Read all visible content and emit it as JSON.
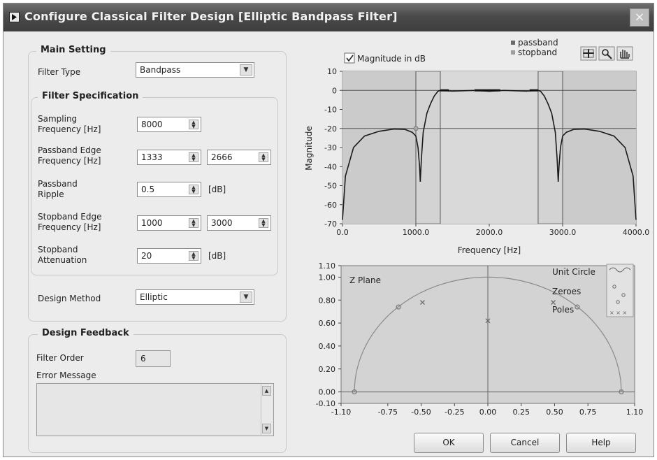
{
  "window": {
    "title": "Configure Classical Filter Design [Elliptic Bandpass Filter]",
    "close_glyph": "×"
  },
  "main_setting": {
    "group_label": "Main Setting",
    "filter_type_label": "Filter Type",
    "filter_type_value": "Bandpass",
    "design_method_label": "Design Method",
    "design_method_value": "Elliptic"
  },
  "filter_spec": {
    "group_label": "Filter Specification",
    "sampling_freq_label": [
      "Sampling",
      "Frequency [Hz]"
    ],
    "sampling_freq_value": "8000",
    "passband_edge_label": [
      "Passband Edge",
      "Frequency [Hz]"
    ],
    "passband_edge_low": "1333",
    "passband_edge_high": "2666",
    "passband_ripple_label": [
      "Passband",
      "Ripple"
    ],
    "passband_ripple_value": "0.5",
    "passband_ripple_unit": "[dB]",
    "stopband_edge_label": [
      "Stopband Edge",
      "Frequency [Hz]"
    ],
    "stopband_edge_low": "1000",
    "stopband_edge_high": "3000",
    "stopband_atten_label": [
      "Stopband",
      "Attenuation"
    ],
    "stopband_atten_value": "20",
    "stopband_atten_unit": "[dB]"
  },
  "feedback": {
    "group_label": "Design Feedback",
    "filter_order_label": "Filter Order",
    "filter_order_value": "6",
    "error_message_label": "Error Message",
    "error_message_value": ""
  },
  "magnitude_plot": {
    "checkbox_label": "Magnitude in dB",
    "checkbox_checked": true,
    "legend": [
      "passband",
      "stopband"
    ],
    "tool_icons": [
      "cursor-grid-icon",
      "zoom-icon",
      "pan-hand-icon"
    ],
    "xlabel": "Frequency [Hz]",
    "ylabel": "Magnitude"
  },
  "zplane_plot": {
    "label": "Z Plane",
    "legend": [
      "Unit Circle",
      "Zeroes",
      "Poles"
    ]
  },
  "buttons": {
    "ok": "OK",
    "cancel": "Cancel",
    "help": "Help"
  },
  "chart_data": [
    {
      "type": "line",
      "title": "",
      "xlabel": "Frequency [Hz]",
      "ylabel": "Magnitude",
      "xlim": [
        0,
        4000
      ],
      "ylim": [
        -70,
        10
      ],
      "x_ticks": [
        "0.0",
        "1000.0",
        "2000.0",
        "3000.0",
        "4000.0"
      ],
      "y_ticks": [
        "10",
        "0",
        "-10",
        "-20",
        "-30",
        "-40",
        "-50",
        "-60",
        "-70"
      ],
      "series": [
        {
          "x": [
            0,
            40,
            150,
            300,
            500,
            700,
            850,
            950,
            1000,
            1030,
            1050,
            1060,
            1075,
            1100,
            1150,
            1200,
            1250,
            1300,
            1333,
            1500,
            1800,
            2000,
            2200,
            2500,
            2666,
            2700,
            2750,
            2800,
            2850,
            2900,
            2925,
            2940,
            2950,
            2970,
            3000,
            3050,
            3150,
            3300,
            3500,
            3700,
            3850,
            3960,
            4000
          ],
          "values": [
            -68,
            -45,
            -30,
            -24,
            -21.5,
            -20.3,
            -20.5,
            -22,
            -24,
            -30,
            -40,
            -48,
            -36,
            -22,
            -12,
            -7,
            -3,
            -0.5,
            0,
            -0.4,
            0,
            -0.5,
            0,
            -0.4,
            0,
            -0.5,
            -3,
            -7,
            -12,
            -22,
            -36,
            -48,
            -40,
            -30,
            -24,
            -22,
            -20.5,
            -20.3,
            -21.5,
            -24,
            -30,
            -45,
            -68
          ]
        }
      ],
      "reference_lines": {
        "x": [
          1000,
          1333,
          2666,
          3000
        ],
        "y": [
          0,
          -20
        ]
      }
    },
    {
      "type": "scatter",
      "title": "",
      "xlim": [
        -1.1,
        1.1
      ],
      "ylim": [
        -0.1,
        1.1
      ],
      "x_ticks": [
        "-1.10",
        "-0.75",
        "-0.50",
        "-0.25",
        "0.00",
        "0.25",
        "0.50",
        "0.75",
        "1.10"
      ],
      "y_ticks": [
        "1.10",
        "1.00",
        "0.80",
        "0.60",
        "0.40",
        "0.20",
        "0.00",
        "-0.10"
      ],
      "series": [
        {
          "name": "Zeroes",
          "points": [
            [
              -1.0,
              0.0
            ],
            [
              -0.67,
              0.74
            ],
            [
              0.67,
              0.74
            ],
            [
              1.0,
              0.0
            ]
          ]
        },
        {
          "name": "Poles",
          "points": [
            [
              -0.49,
              0.78
            ],
            [
              0.0,
              0.62
            ],
            [
              0.49,
              0.78
            ]
          ]
        }
      ]
    }
  ]
}
